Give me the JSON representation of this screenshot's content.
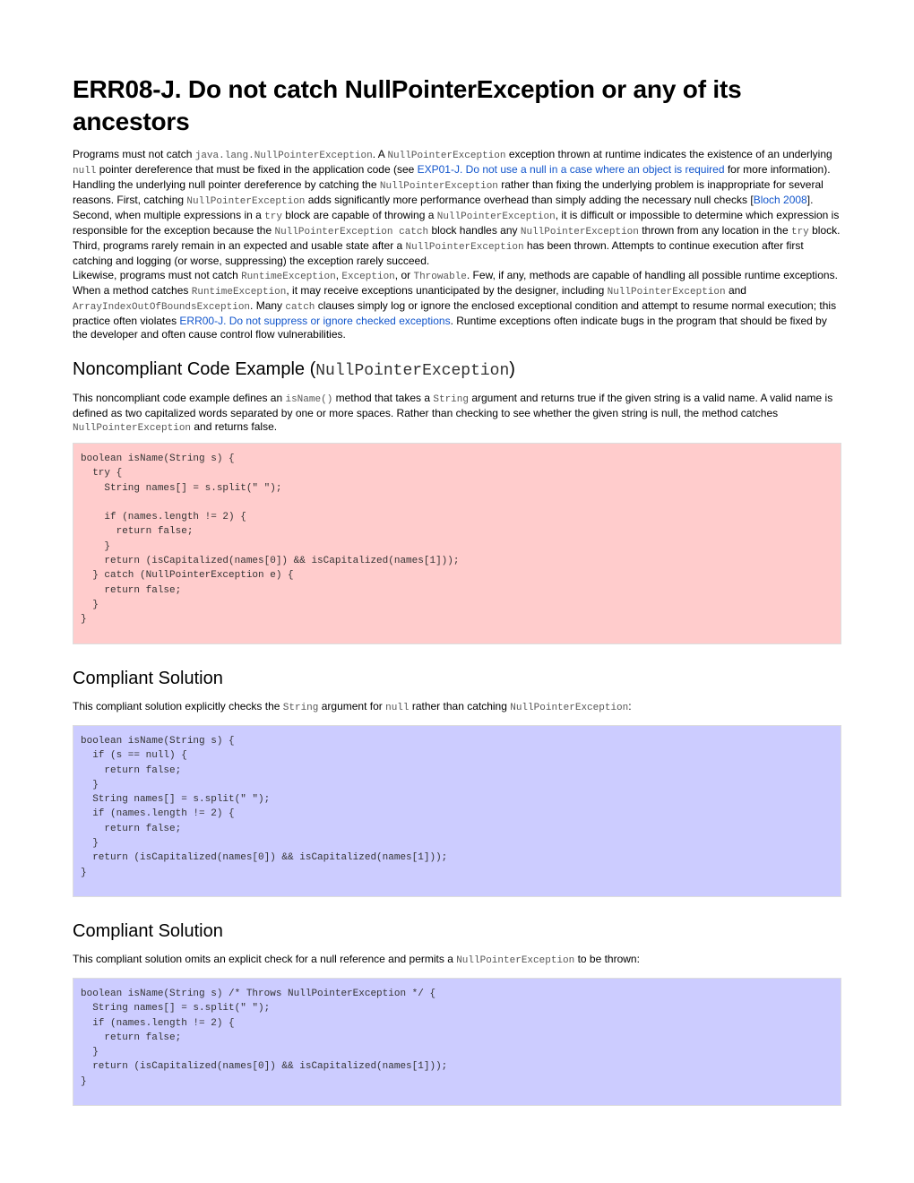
{
  "title": "ERR08-J. Do not catch NullPointerException or any of its ancestors",
  "intro": {
    "p1": [
      {
        "t": "text",
        "v": "Programs must not catch "
      },
      {
        "t": "code",
        "v": "java.lang.NullPointerException"
      },
      {
        "t": "text",
        "v": ". A "
      },
      {
        "t": "code",
        "v": "NullPointerException"
      },
      {
        "t": "text",
        "v": " exception thrown at runtime indicates the existence of an underlying "
      },
      {
        "t": "code",
        "v": "null"
      },
      {
        "t": "text",
        "v": " pointer dereference that must be fixed in the application code (see "
      },
      {
        "t": "link",
        "v": "EXP01-J. Do not use a null in a case where an object is required"
      },
      {
        "t": "text",
        "v": " for more information). Handling the underlying null pointer dereference by catching the "
      },
      {
        "t": "code",
        "v": "NullPointerException"
      },
      {
        "t": "text",
        "v": " rather than fixing the underlying problem is inappropriate for several reasons. First, catching "
      },
      {
        "t": "code",
        "v": "NullPointerException"
      },
      {
        "t": "text",
        "v": " adds significantly more performance overhead than simply adding the necessary null checks ["
      },
      {
        "t": "link",
        "v": "Bloch 2008"
      },
      {
        "t": "text",
        "v": "]. Second, when multiple expressions in a "
      },
      {
        "t": "code",
        "v": "try"
      },
      {
        "t": "text",
        "v": " block are capable of throwing a "
      },
      {
        "t": "code",
        "v": "NullPointerException"
      },
      {
        "t": "text",
        "v": ", it is difficult or impossible to determine which expression is responsible for the exception because the "
      },
      {
        "t": "code",
        "v": "NullPointerException catch"
      },
      {
        "t": "text",
        "v": " block handles any "
      },
      {
        "t": "code",
        "v": "NullPointerException"
      },
      {
        "t": "text",
        "v": " thrown from any location in the "
      },
      {
        "t": "code",
        "v": "try"
      },
      {
        "t": "text",
        "v": " block. Third, programs rarely remain in an expected and usable state after a "
      },
      {
        "t": "code",
        "v": "NullPointerException"
      },
      {
        "t": "text",
        "v": " has been thrown. Attempts to continue execution after first catching and logging (or worse, suppressing) the exception rarely succeed."
      }
    ],
    "p2": [
      {
        "t": "text",
        "v": "Likewise, programs must not catch "
      },
      {
        "t": "code",
        "v": "RuntimeException"
      },
      {
        "t": "text",
        "v": ", "
      },
      {
        "t": "code",
        "v": "Exception"
      },
      {
        "t": "text",
        "v": ", or "
      },
      {
        "t": "code",
        "v": "Throwable"
      },
      {
        "t": "text",
        "v": ". Few, if any, methods are capable of handling all possible runtime exceptions. When a method catches "
      },
      {
        "t": "code",
        "v": "RuntimeException"
      },
      {
        "t": "text",
        "v": ", it may receive exceptions unanticipated by the designer, including "
      },
      {
        "t": "code",
        "v": "NullPointerException"
      },
      {
        "t": "text",
        "v": " and "
      },
      {
        "t": "code",
        "v": "ArrayIndexOutOfBoundsException"
      },
      {
        "t": "text",
        "v": ". Many "
      },
      {
        "t": "code",
        "v": "catch"
      },
      {
        "t": "text",
        "v": " clauses simply log or ignore the enclosed exceptional condition and attempt to resume normal execution; this practice often violates "
      },
      {
        "t": "link",
        "v": "ERR00-J. Do not suppress or ignore checked exceptions"
      },
      {
        "t": "text",
        "v": ". Runtime exceptions often indicate bugs in the program that should be fixed by the developer and often cause control flow vulnerabilities."
      }
    ]
  },
  "noncompliant": {
    "heading_text": "Noncompliant Code Example (",
    "heading_code": "NullPointerException",
    "heading_close": ")",
    "description": [
      {
        "t": "text",
        "v": "This noncompliant code example defines an "
      },
      {
        "t": "code",
        "v": "isName()"
      },
      {
        "t": "text",
        "v": " method that takes a "
      },
      {
        "t": "code",
        "v": "String"
      },
      {
        "t": "text",
        "v": " argument and returns true if the given string is a valid name. A valid name is defined as two capitalized words separated by one or more spaces. Rather than checking to see whether the given string is null, the method catches "
      },
      {
        "t": "code",
        "v": "NullPointerException"
      },
      {
        "t": "text",
        "v": " and returns false."
      }
    ],
    "code": "boolean isName(String s) {\n  try {\n    String names[] = s.split(\" \");\n\n    if (names.length != 2) {\n      return false;\n    }\n    return (isCapitalized(names[0]) && isCapitalized(names[1]));\n  } catch (NullPointerException e) {\n    return false;\n  }\n}"
  },
  "compliant1": {
    "heading": "Compliant Solution",
    "description": [
      {
        "t": "text",
        "v": "This compliant solution explicitly checks the "
      },
      {
        "t": "code",
        "v": "String"
      },
      {
        "t": "text",
        "v": " argument for "
      },
      {
        "t": "code",
        "v": "null"
      },
      {
        "t": "text",
        "v": " rather than catching "
      },
      {
        "t": "code",
        "v": "NullPointerException"
      },
      {
        "t": "text",
        "v": ":"
      }
    ],
    "code": "boolean isName(String s) {\n  if (s == null) {\n    return false;\n  }\n  String names[] = s.split(\" \");\n  if (names.length != 2) {\n    return false;\n  }\n  return (isCapitalized(names[0]) && isCapitalized(names[1]));\n}"
  },
  "compliant2": {
    "heading": "Compliant Solution",
    "description": [
      {
        "t": "text",
        "v": "This compliant solution omits an explicit check for a null reference and permits a "
      },
      {
        "t": "code",
        "v": "NullPointerException"
      },
      {
        "t": "text",
        "v": " to be thrown:"
      }
    ],
    "code": "boolean isName(String s) /* Throws NullPointerException */ {\n  String names[] = s.split(\" \");\n  if (names.length != 2) {\n    return false;\n  }\n  return (isCapitalized(names[0]) && isCapitalized(names[1]));\n}"
  },
  "colors": {
    "link": "#1155cc",
    "noncompliant_bg": "#ffcccc",
    "compliant_bg": "#ccccff"
  }
}
